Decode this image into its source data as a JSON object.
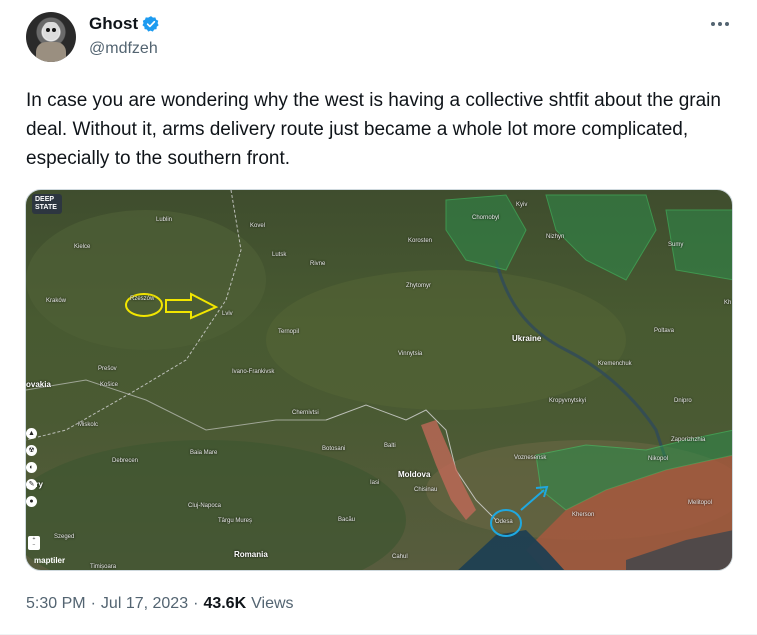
{
  "author": {
    "name": "Ghost",
    "handle": "@mdfzeh",
    "verified_color": "#1d9bf0"
  },
  "tweet_text": "In case you are wondering why the west is having a collective shtfit about the grain deal. Without it, arms delivery route just became a whole lot more complicated, especially to the southern front.",
  "media": {
    "badge": "DEEP STATE",
    "attribution": "maptiler",
    "labels": [
      {
        "text": "Lublin"
      },
      {
        "text": "Kielce"
      },
      {
        "text": "Kraków"
      },
      {
        "text": "Rzeszów"
      },
      {
        "text": "Lviv"
      },
      {
        "text": "Kovel"
      },
      {
        "text": "Lutsk"
      },
      {
        "text": "Rivne"
      },
      {
        "text": "Korosten"
      },
      {
        "text": "Zhytomyr"
      },
      {
        "text": "Chornobyl"
      },
      {
        "text": "Nizhyn"
      },
      {
        "text": "Sumy"
      },
      {
        "text": "Ternopil"
      },
      {
        "text": "Vinnytsia"
      },
      {
        "text": "Ukraine"
      },
      {
        "text": "Poltava"
      },
      {
        "text": "Kremenchuk"
      },
      {
        "text": "Dnipro"
      },
      {
        "text": "Ivano-Frankivsk"
      },
      {
        "text": "Prešov"
      },
      {
        "text": "Košice"
      },
      {
        "text": "ovakia"
      },
      {
        "text": "Miskolc"
      },
      {
        "text": "Chernivtsi"
      },
      {
        "text": "Kropyvnytskyi"
      },
      {
        "text": "Zaporizhzhia"
      },
      {
        "text": "Balti"
      },
      {
        "text": "Botosani"
      },
      {
        "text": "Debrecen"
      },
      {
        "text": "Baia Mare"
      },
      {
        "text": "Moldova"
      },
      {
        "text": "Chisinau"
      },
      {
        "text": "Iasi"
      },
      {
        "text": "Nikopol"
      },
      {
        "text": "Cluj-Napoca"
      },
      {
        "text": "Târgu Mureș"
      },
      {
        "text": "Bacău"
      },
      {
        "text": "Odesa"
      },
      {
        "text": "Romania"
      },
      {
        "text": "Szeged"
      },
      {
        "text": "Timișoara"
      },
      {
        "text": "Cahul"
      },
      {
        "text": "Voznesensk"
      },
      {
        "text": "Kherson"
      },
      {
        "text": "Melitopol"
      },
      {
        "text": "Kyiv"
      },
      {
        "text": "gary"
      },
      {
        "text": "Kh"
      }
    ]
  },
  "meta": {
    "time": "5:30 PM",
    "sep": "·",
    "date": "Jul 17, 2023",
    "views_count": "43.6K",
    "views_label": "Views"
  }
}
